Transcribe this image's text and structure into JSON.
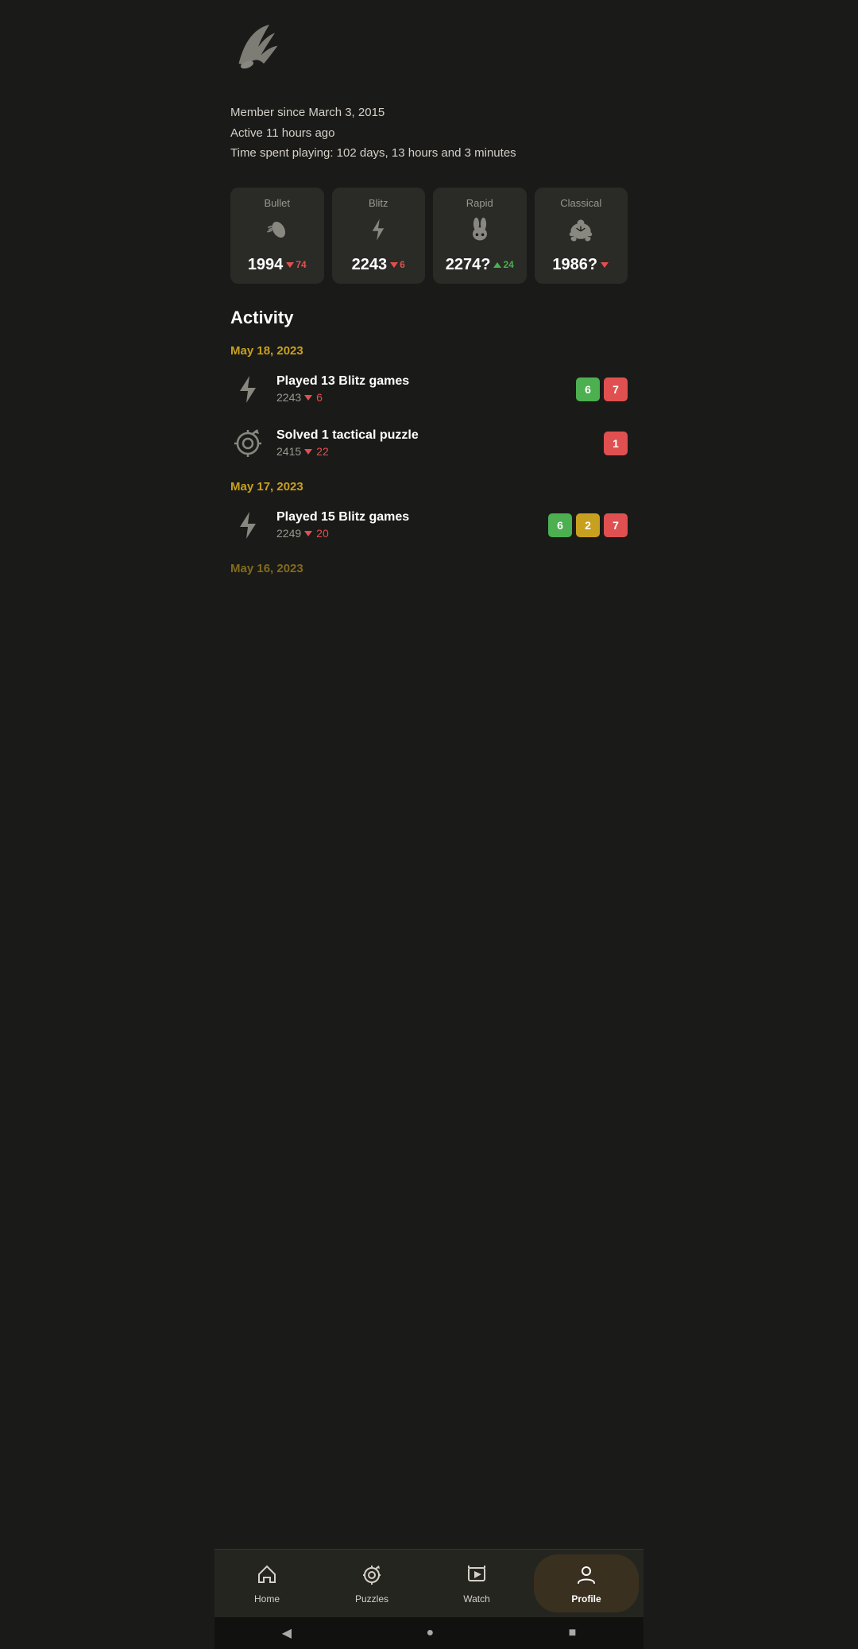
{
  "header": {
    "logo_alt": "Lichess logo"
  },
  "user_info": {
    "member_since": "Member since March 3, 2015",
    "active": "Active 11 hours ago",
    "time_playing": "Time spent playing: 102 days, 13 hours and 3 minutes"
  },
  "ratings": [
    {
      "label": "Bullet",
      "icon": "bullet",
      "value": "1994",
      "diff": "74",
      "diff_dir": "down"
    },
    {
      "label": "Blitz",
      "icon": "blitz",
      "value": "2243",
      "diff": "6",
      "diff_dir": "down"
    },
    {
      "label": "Rapid",
      "icon": "rapid",
      "value": "2274?",
      "diff": "24",
      "diff_dir": "up"
    },
    {
      "label": "Classical",
      "icon": "classical",
      "value": "1986?",
      "diff": "...",
      "diff_dir": "down"
    }
  ],
  "activity": {
    "section_title": "Activity",
    "dates": [
      {
        "date": "May 18, 2023",
        "items": [
          {
            "type": "blitz",
            "title": "Played 13 Blitz games",
            "rating": "2243",
            "diff": "6",
            "diff_dir": "down",
            "badges": [
              {
                "value": "6",
                "color": "green"
              },
              {
                "value": "7",
                "color": "red"
              }
            ]
          },
          {
            "type": "puzzle",
            "title": "Solved 1 tactical puzzle",
            "rating": "2415",
            "diff": "22",
            "diff_dir": "down",
            "badges": [
              {
                "value": "1",
                "color": "red"
              }
            ]
          }
        ]
      },
      {
        "date": "May 17, 2023",
        "items": [
          {
            "type": "blitz",
            "title": "Played 15 Blitz games",
            "rating": "2249",
            "diff": "20",
            "diff_dir": "down",
            "badges": [
              {
                "value": "6",
                "color": "green"
              },
              {
                "value": "2",
                "color": "orange"
              },
              {
                "value": "7",
                "color": "red"
              }
            ]
          }
        ]
      },
      {
        "date": "May 16, 2023",
        "items": []
      }
    ]
  },
  "bottom_nav": {
    "items": [
      {
        "id": "home",
        "label": "Home",
        "icon": "home",
        "active": false
      },
      {
        "id": "puzzles",
        "label": "Puzzles",
        "icon": "puzzles",
        "active": false
      },
      {
        "id": "watch",
        "label": "Watch",
        "icon": "watch",
        "active": false
      },
      {
        "id": "profile",
        "label": "Profile",
        "icon": "profile",
        "active": true
      }
    ]
  },
  "system_bar": {
    "back": "◀",
    "home": "●",
    "recent": "■"
  }
}
